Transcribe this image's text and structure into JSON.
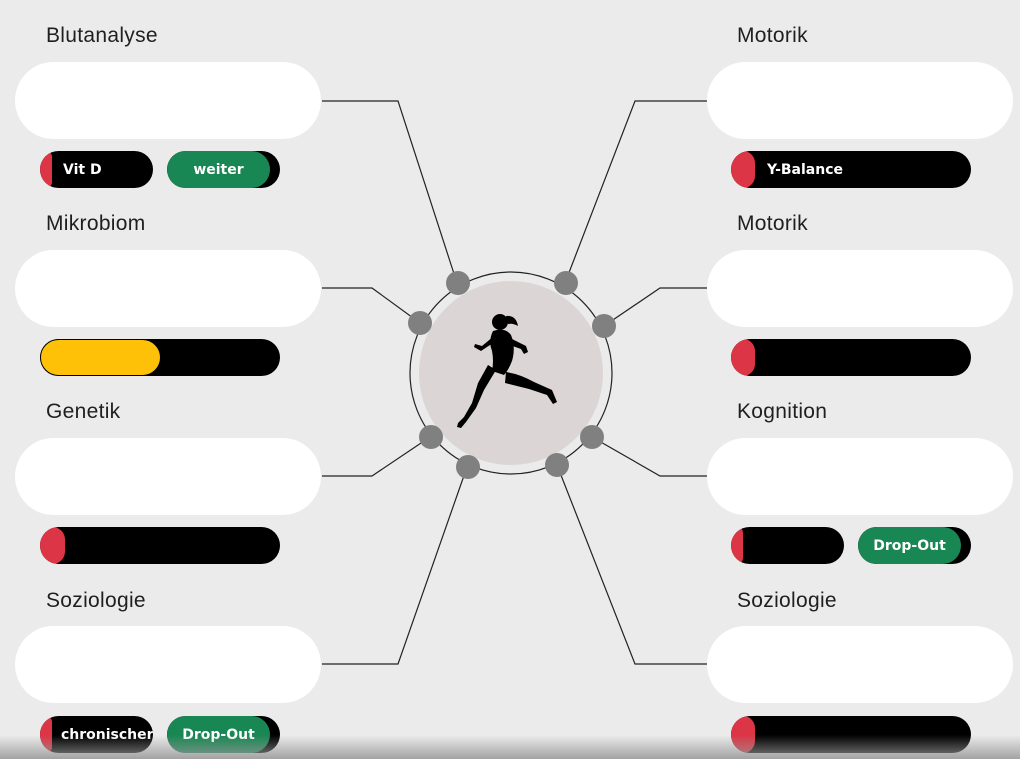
{
  "center": {
    "icon": "running-woman-icon"
  },
  "colors": {
    "background": "#ebebeb",
    "card": "#ffffff",
    "red": "#dc3545",
    "yellow": "#ffc107",
    "green": "#198754",
    "node": "#808080",
    "circle_fill": "#dcd5d5"
  },
  "panels": [
    {
      "title": "Blutanalyse",
      "bar": {
        "label": "Vit D",
        "level": "red"
      },
      "button": {
        "label": "weiter"
      }
    },
    {
      "title": "Mikrobiom",
      "bar": {
        "label": "",
        "level": "yellow",
        "fill": 0.5
      }
    },
    {
      "title": "Genetik",
      "bar": {
        "label": "",
        "level": "red"
      }
    },
    {
      "title": "Soziologie",
      "bar": {
        "label": "chronischer",
        "level": "red"
      },
      "button": {
        "label": "Drop-Out"
      }
    },
    {
      "title": "Motorik",
      "bar": {
        "label": "Y-Balance",
        "level": "red"
      }
    },
    {
      "title": "Motorik",
      "bar": {
        "label": "",
        "level": "red"
      }
    },
    {
      "title": "Kognition",
      "bar": {
        "label": "",
        "level": "red"
      },
      "button": {
        "label": "Drop-Out"
      }
    },
    {
      "title": "Soziologie",
      "bar": {
        "label": "",
        "level": "red"
      }
    }
  ]
}
